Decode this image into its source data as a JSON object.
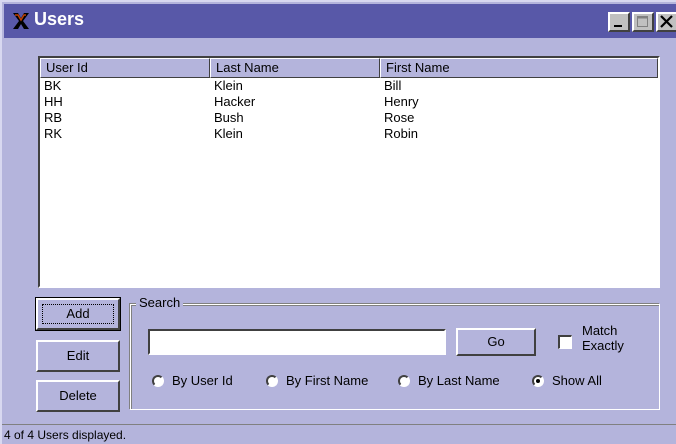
{
  "window": {
    "title": "Users",
    "controls": {
      "minimize": "minimize",
      "maximize": "maximize",
      "close": "close"
    }
  },
  "list": {
    "columns": [
      "User Id",
      "Last Name",
      "First Name"
    ],
    "rows": [
      [
        "BK",
        "Klein",
        "Bill"
      ],
      [
        "HH",
        "Hacker",
        "Henry"
      ],
      [
        "RB",
        "Bush",
        "Rose"
      ],
      [
        "RK",
        "Klein",
        "Robin"
      ]
    ]
  },
  "buttons": {
    "add": "Add",
    "edit": "Edit",
    "delete": "Delete"
  },
  "search": {
    "group_label": "Search",
    "input_value": "",
    "go": "Go",
    "match_exactly": "Match\nExactly",
    "match_exactly_checked": false,
    "radios": [
      {
        "label": "By User Id",
        "selected": false
      },
      {
        "label": "By First Name",
        "selected": false
      },
      {
        "label": "By Last Name",
        "selected": false
      },
      {
        "label": "Show All",
        "selected": true
      }
    ]
  },
  "status": {
    "text": "4 of 4 Users displayed."
  },
  "icons": {
    "app": "x-app-icon"
  }
}
